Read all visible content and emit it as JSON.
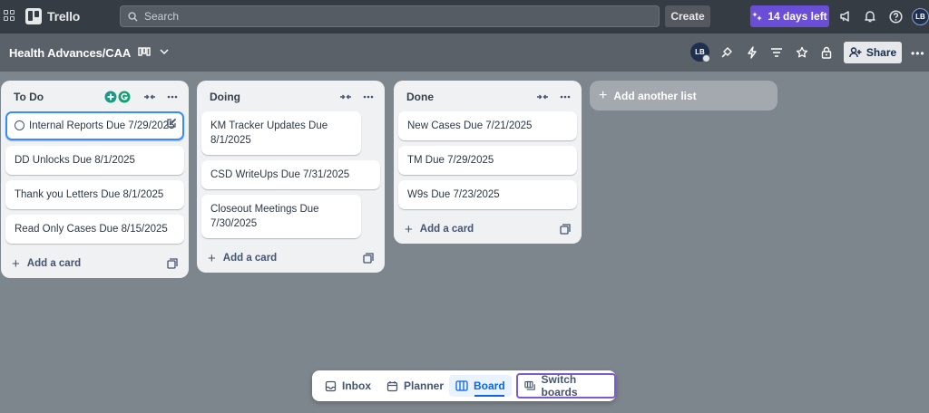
{
  "topnav": {
    "app_name": "Trello",
    "search_placeholder": "Search",
    "create_label": "Create",
    "trial_label": "14 days left",
    "avatar_initials": "LB"
  },
  "board": {
    "title": "Health Advances/CAA",
    "member_initials": "LB",
    "share_label": "Share"
  },
  "lists": [
    {
      "title": "To Do",
      "cards": [
        "Internal Reports Due 7/29/2025",
        "DD Unlocks Due 8/1/2025",
        "Thank you Letters Due 8/1/2025",
        "Read Only Cases Due 8/15/2025"
      ],
      "add_label": "Add a card"
    },
    {
      "title": "Doing",
      "cards": [
        "KM Tracker Updates Due 8/1/2025",
        "CSD WriteUps Due 7/31/2025",
        "Closeout Meetings Due 7/30/2025"
      ],
      "add_label": "Add a card"
    },
    {
      "title": "Done",
      "cards": [
        "New Cases Due 7/21/2025",
        "TM Due 7/29/2025",
        "W9s Due 7/23/2025"
      ],
      "add_label": "Add a card"
    }
  ],
  "add_list_label": "Add another list",
  "switcher": {
    "inbox": "Inbox",
    "planner": "Planner",
    "board": "Board",
    "switch_boards": "Switch boards"
  },
  "colors": {
    "nav_bg": "#363c44",
    "board_bg": "#7e868d",
    "trial_purple": "#6a4fd6",
    "focus_blue": "#388bff",
    "active_blue": "#0c66e4"
  }
}
